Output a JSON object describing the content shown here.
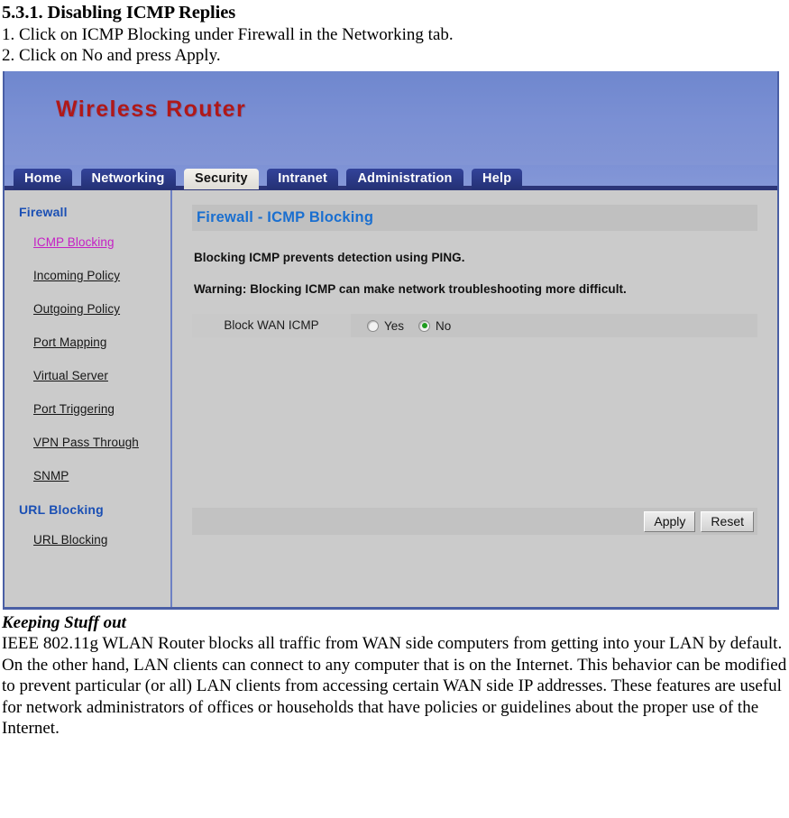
{
  "document": {
    "section_heading": "5.3.1. Disabling ICMP Replies",
    "steps": [
      "1. Click on ICMP Blocking under Firewall in the Networking tab.",
      "2. Click on No and press Apply."
    ],
    "footer_title": "Keeping Stuff out",
    "footer_paragraphs": [
      "IEEE 802.11g WLAN Router blocks all traffic from WAN side computers from getting into your LAN by default.",
      "On the other hand, LAN clients can connect to any computer that is on the Internet. This behavior can be modified to prevent particular (or all) LAN clients from accessing certain WAN side IP addresses. These features are useful for network administrators of offices or households that have policies or guidelines about the proper use of the Internet."
    ]
  },
  "router_ui": {
    "brand_title": "Wireless Router",
    "brand_color": "#b01818",
    "banner_color": "#7b90d4",
    "tabs": [
      {
        "label": "Home",
        "active": false
      },
      {
        "label": "Networking",
        "active": false
      },
      {
        "label": "Security",
        "active": true
      },
      {
        "label": "Intranet",
        "active": false
      },
      {
        "label": "Administration",
        "active": false
      },
      {
        "label": "Help",
        "active": false
      }
    ],
    "sidebar": {
      "groups": [
        {
          "title": "Firewall",
          "items": [
            {
              "label": "ICMP Blocking",
              "current": true
            },
            {
              "label": "Incoming Policy",
              "current": false
            },
            {
              "label": "Outgoing Policy",
              "current": false
            },
            {
              "label": "Port Mapping",
              "current": false
            },
            {
              "label": "Virtual Server",
              "current": false
            },
            {
              "label": "Port Triggering",
              "current": false
            },
            {
              "label": "VPN Pass Through",
              "current": false
            },
            {
              "label": "SNMP",
              "current": false
            }
          ]
        },
        {
          "title": "URL Blocking",
          "items": [
            {
              "label": "URL Blocking",
              "current": false
            }
          ]
        }
      ],
      "group_color": "#1a4fb4",
      "current_link_color": "#c420c4"
    },
    "content": {
      "title": "Firewall - ICMP Blocking",
      "title_color": "#1a6fd0",
      "notes": [
        "Blocking ICMP prevents detection using PING.",
        "Warning: Blocking ICMP can make network troubleshooting more difficult."
      ],
      "setting": {
        "label": "Block WAN ICMP",
        "options": [
          {
            "label": "Yes",
            "selected": false
          },
          {
            "label": "No",
            "selected": true
          }
        ],
        "selected_value": "No",
        "selected_indicator_color": "#1e9c1e"
      },
      "buttons": [
        {
          "label": "Apply"
        },
        {
          "label": "Reset"
        }
      ]
    }
  }
}
